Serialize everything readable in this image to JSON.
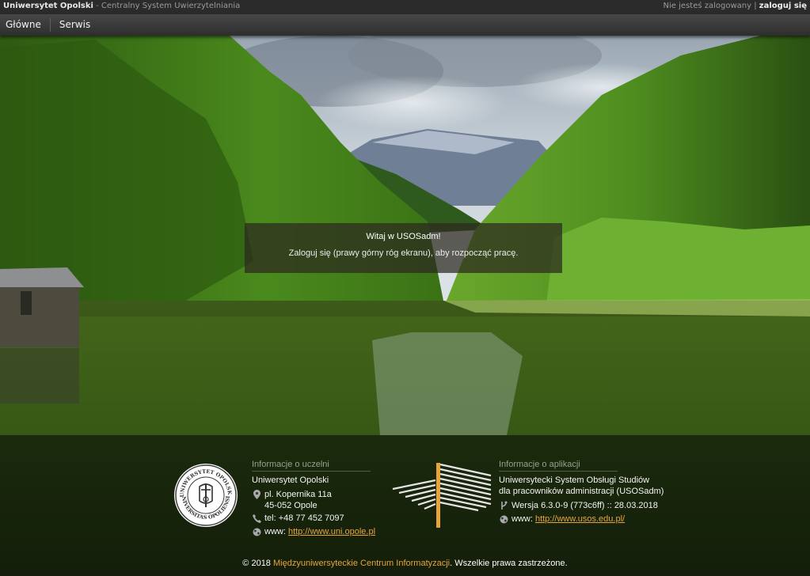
{
  "topbar": {
    "brand": "Uniwersytet Opolski",
    "separator": " - ",
    "subtitle": "Centralny System Uwierzytelniania",
    "status": "Nie jesteś zalogowany",
    "divider": " | ",
    "login_label": "zaloguj się"
  },
  "nav": {
    "items": [
      {
        "label": "Główne"
      },
      {
        "label": "Serwis"
      }
    ]
  },
  "welcome": {
    "title": "Witaj w USOSadm!",
    "message": "Zaloguj się (prawy górny róg ekranu), aby rozpocząć pracę."
  },
  "footer": {
    "university": {
      "heading": "Informacje o uczelni",
      "name": "Uniwersytet Opolski",
      "address_line1": "pl. Kopernika 11a",
      "address_line2": "45-052 Opole",
      "phone": "tel: +48 77 452 7097",
      "www_label": "www: ",
      "www_url": "http://www.uni.opole.pl",
      "seal_text_top": "UNIWERSYTET OPOLSKI",
      "seal_text_bottom": "UNIVERSITAS OPOLIENSIS"
    },
    "application": {
      "heading": "Informacje o aplikacji",
      "name_line1": "Uniwersytecki System Obsługi Studiów",
      "name_line2": "dla pracowników administracji (USOSadm)",
      "version": "Wersja 6.3.0-9 (773c6ff) :: 28.03.2018",
      "www_label": "www: ",
      "www_url": "http://www.usos.edu.pl/"
    },
    "copyright": {
      "prefix": "© 2018 ",
      "org": "Międzyuniwersyteckie Centrum Informatyzacji",
      "suffix": ". Wszelkie prawa zastrzeżone."
    }
  },
  "colors": {
    "accent": "#e8a43c",
    "topbar": "#2b2b2b",
    "navbar": "#3a3a3a"
  }
}
